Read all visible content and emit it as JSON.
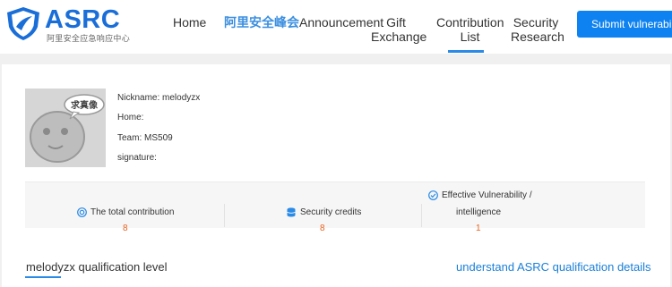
{
  "header": {
    "logo_text": "ASRC",
    "logo_subtitle": "阿里安全应急响应中心",
    "brand_color": "#1a6ed8",
    "nav": {
      "home": "Home",
      "summit": "阿里安全峰会",
      "announcement": "Announcement",
      "gift_line1": "Gift",
      "gift_line2": "Exchange",
      "contribution_line1": "Contribution",
      "contribution_line2": "List",
      "security_line1": "Security",
      "security_line2": "Research"
    },
    "active_nav": "contribution",
    "submit_label": "Submit vulnerabil",
    "accent_color": "#0e82f0"
  },
  "profile": {
    "avatar_caption": "求真像",
    "nickname": "Nickname: melodyzx",
    "home": "Home:",
    "team": "Team: MS509",
    "signature": "signature:"
  },
  "stats": {
    "total_contribution": {
      "icon": "target-icon",
      "label": "The total contribution",
      "value": "8"
    },
    "security_credits": {
      "icon": "database-icon",
      "label": "Security credits",
      "value": "8"
    },
    "effective_vulnerability": {
      "icon": "check-circle-icon",
      "label_line1": "Effective Vulnerability /",
      "label_line2": "intelligence",
      "value": "1"
    },
    "value_color": "#e8631d"
  },
  "qualification": {
    "title": "melodyzx qualification level",
    "link": "understand ASRC qualification details"
  }
}
